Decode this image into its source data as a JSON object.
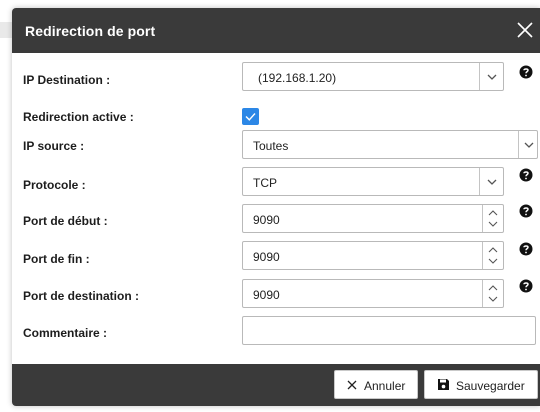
{
  "dialog": {
    "title": "Redirection de port",
    "close_icon": "close-icon"
  },
  "form": {
    "ip_destination": {
      "label": "IP Destination :",
      "value": "(192.168.1.20)",
      "help_icon": "help-icon"
    },
    "redirection_active": {
      "label": "Redirection active :",
      "checked": true
    },
    "ip_source": {
      "label": "IP source :",
      "value": "Toutes"
    },
    "protocole": {
      "label": "Protocole :",
      "value": "TCP",
      "help_icon": "help-icon"
    },
    "port_debut": {
      "label": "Port de début :",
      "value": "9090",
      "help_icon": "help-icon"
    },
    "port_fin": {
      "label": "Port de fin :",
      "value": "9090",
      "help_icon": "help-icon"
    },
    "port_destination": {
      "label": "Port de destination :",
      "value": "9090",
      "help_icon": "help-icon"
    },
    "commentaire": {
      "label": "Commentaire :",
      "value": ""
    }
  },
  "footer": {
    "cancel_label": "Annuler",
    "save_label": "Sauvegarder"
  },
  "colors": {
    "titlebar": "#3a3a3a",
    "checkbox": "#2c87e6"
  }
}
